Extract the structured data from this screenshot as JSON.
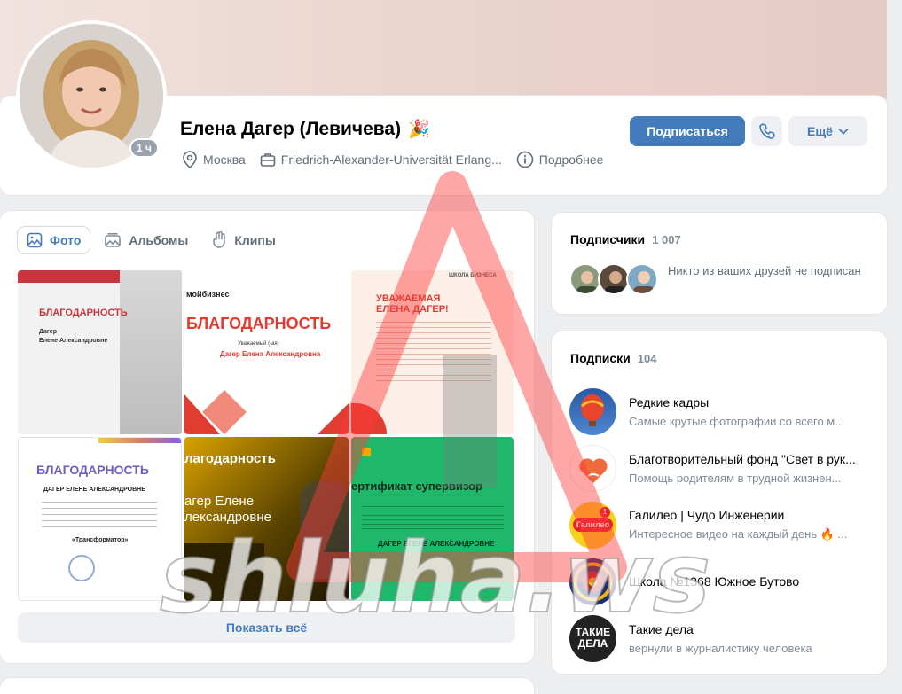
{
  "profile": {
    "name": "Елена Дагер (Левичева)",
    "online": "1 ч",
    "city": "Москва",
    "university": "Friedrich-Alexander-Universität Erlang...",
    "more_info": "Подробнее",
    "subscribe_label": "Подписаться",
    "more_label": "Ещё"
  },
  "photos": {
    "tabs": [
      {
        "label": "Фото",
        "icon": "photo-icon"
      },
      {
        "label": "Альбомы",
        "icon": "albums-icon"
      },
      {
        "label": "Клипы",
        "icon": "clips-icon"
      }
    ],
    "show_all": "Показать всё",
    "items": [
      {
        "title": "БЛАГОДАРНОСТЬ",
        "line1": "Дагер",
        "line2": "Елене Александровне"
      },
      {
        "brand": "мойбизнес",
        "title": "БЛАГОДАРНОСТЬ",
        "line1": "Уважаемый (-ая)",
        "line2": "Дагер Елена Александровна"
      },
      {
        "title": "УВАЖАЕМАЯ",
        "line1": "ЕЛЕНА ДАГЕР!",
        "brand": "ШКОЛА БИЗНЕСА"
      },
      {
        "title": "БЛАГОДАРНОСТЬ",
        "line1": "ДАГЕР ЕЛЕНЕ АЛЕКСАНДРОВНЕ",
        "line2": "«Трансформатор»"
      },
      {
        "title": "лагодарность",
        "line1": "агер Елене",
        "line2": "лександровне"
      },
      {
        "title": "ертификат супервизор",
        "line1": "ДАГЕР ЕЛЕНЕ АЛЕКСАНДРОВНЕ"
      }
    ]
  },
  "followers": {
    "title": "Подписчики",
    "count": "1 007",
    "note": "Никто из ваших друзей не подписан"
  },
  "subscriptions": {
    "title": "Подписки",
    "count": "104",
    "items": [
      {
        "name": "Редкие кадры",
        "desc": "Самые крутые фотографии со всего м..."
      },
      {
        "name": "Благотворительный фонд \"Свет в рук...",
        "desc": "Помощь родителям в трудной жизнен..."
      },
      {
        "name": "Галилео | Чудо Инженерии",
        "desc": "Интересное видео на каждый день 🔥 ..."
      },
      {
        "name": "Школа №1368 Южное Бутово",
        "desc": ""
      },
      {
        "name": "Такие дела",
        "desc": "вернули в журналистику человека"
      }
    ]
  },
  "logos": {
    "galileo": "Галилео",
    "takie_dela_1": "ТАКИЕ",
    "takie_dela_2": "ДЕЛА"
  },
  "watermark": "shluha.ws"
}
